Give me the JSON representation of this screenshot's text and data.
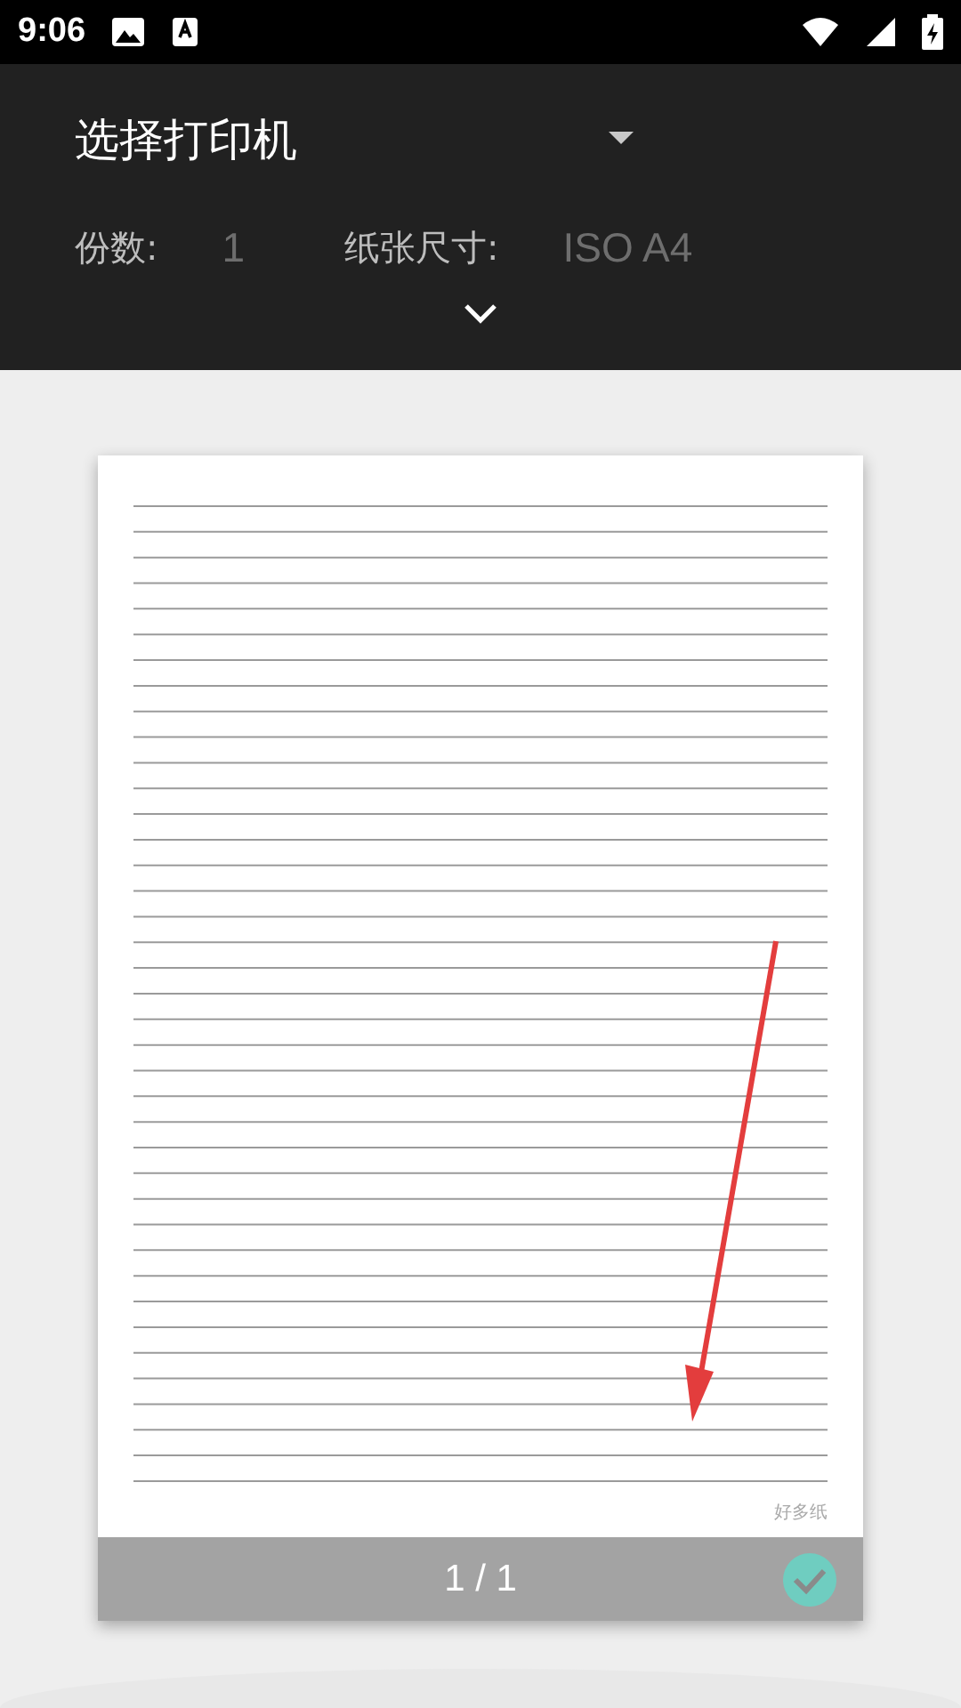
{
  "status_bar": {
    "time": "9:06"
  },
  "printer": {
    "title": "选择打印机"
  },
  "options": [
    {
      "label": "份数:",
      "value": "1"
    },
    {
      "label": "纸张尺寸:",
      "value": "ISO A4"
    }
  ],
  "preview": {
    "page_footer": "好多纸",
    "page_number": "1 / 1",
    "selected": true
  }
}
